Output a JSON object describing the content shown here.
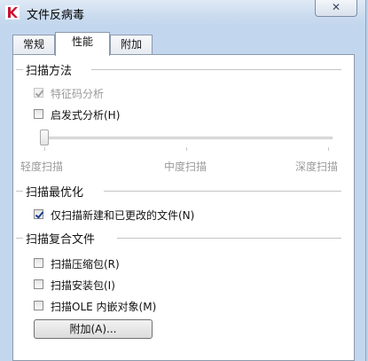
{
  "window": {
    "title": "文件反病毒",
    "close_label": "✕"
  },
  "tabs": [
    {
      "label": "常规",
      "active": false
    },
    {
      "label": "性能",
      "active": true
    },
    {
      "label": "附加",
      "active": false
    }
  ],
  "scan_method": {
    "title": "扫描方法",
    "options": [
      {
        "label": "特征码分析",
        "checked": true,
        "disabled": true
      },
      {
        "label": "启发式分析(H)",
        "checked": false,
        "disabled": false
      }
    ],
    "slider": {
      "labels": [
        "轻度扫描",
        "中度扫描",
        "深度扫描"
      ],
      "level": 0
    }
  },
  "scan_optimize": {
    "title": "扫描最优化",
    "options": [
      {
        "label": "仅扫描新建和已更改的文件(N)",
        "checked": true,
        "disabled": false
      }
    ]
  },
  "compound_files": {
    "title": "扫描复合文件",
    "options": [
      {
        "label": "扫描压缩包(R)",
        "checked": false,
        "disabled": false
      },
      {
        "label": "扫描安装包(I)",
        "checked": false,
        "disabled": false
      },
      {
        "label": "扫描OLE 内嵌对象(M)",
        "checked": false,
        "disabled": false
      }
    ],
    "button_label": "附加(A)..."
  },
  "colors": {
    "window_bg": "#c2d6ee",
    "panel_bg": "#ffffff",
    "check": "#1b3f8f"
  }
}
